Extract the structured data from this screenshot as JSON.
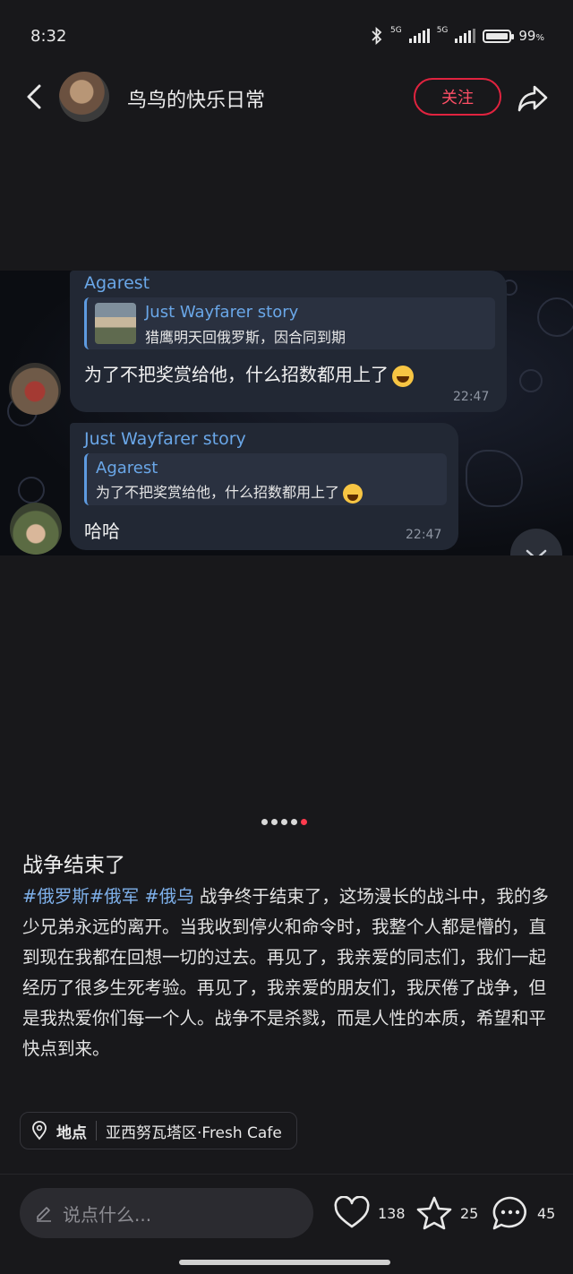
{
  "status_bar": {
    "time": "8:32",
    "network_1": "5G",
    "network_2": "5G",
    "battery": "99",
    "battery_unit": "%"
  },
  "header": {
    "title": "鸟鸟的快乐日常",
    "follow_label": "关注"
  },
  "image": {
    "messages": [
      {
        "sender": "Agarest",
        "quote_name": "Just Wayfarer story",
        "quote_text": "猎鹰明天回俄罗斯，因合同到期",
        "text": "为了不把奖赏给他，什么招数都用上了",
        "time": "22:47"
      },
      {
        "sender": "Just Wayfarer story",
        "quote_name": "Agarest",
        "quote_text": "为了不把奖赏给他，什么招数都用上了",
        "text": "哈哈",
        "time": "22:47"
      }
    ]
  },
  "pager": {
    "count": 5,
    "active_index": 4
  },
  "post": {
    "title": "战争结束了",
    "tags": [
      "#俄罗斯",
      "#俄军",
      " #俄乌"
    ],
    "body": " 战争终于结束了，这场漫长的战斗中，我的多少兄弟永远的离开。当我收到停火和命令时，我整个人都是懵的，直到现在我都在回想一切的过去。再见了，我亲爱的同志们，我们一起经历了很多生死考验。再见了，我亲爱的朋友们，我厌倦了战争，但是我热爱你们每一个人。战争不是杀戮，而是人性的本质，希望和平快点到来。"
  },
  "location": {
    "label": "地点",
    "value": "亚西努瓦塔区·Fresh Cafe"
  },
  "bottom_bar": {
    "comment_placeholder": "说点什么...",
    "likes": "138",
    "favorites": "25",
    "comments": "45"
  },
  "colors": {
    "accent": "#e0233f",
    "link": "#7eb0ea",
    "background": "#18181b"
  }
}
